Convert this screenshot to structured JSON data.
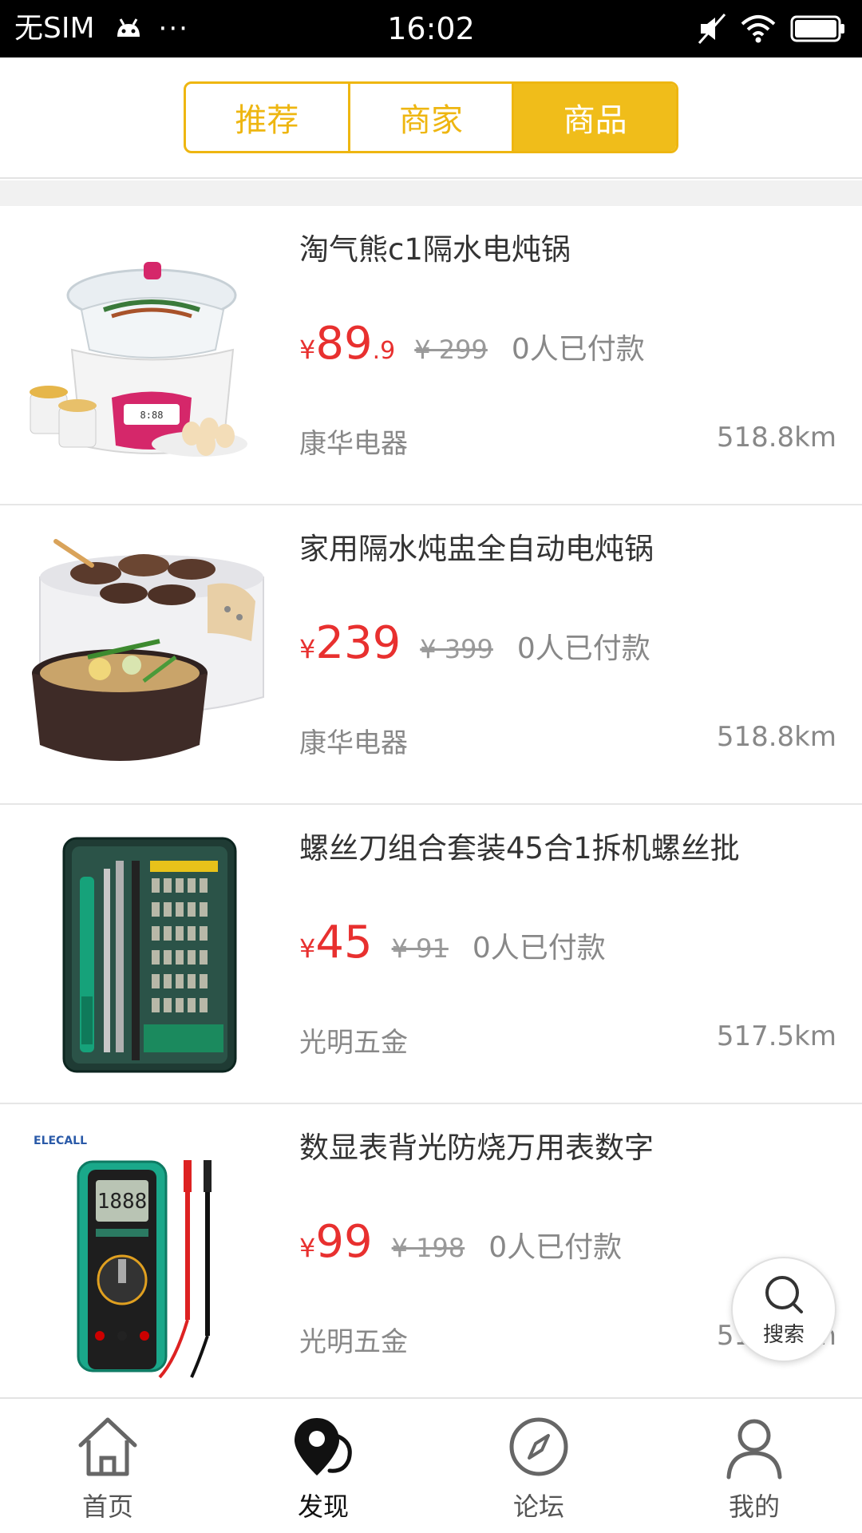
{
  "status_bar": {
    "carrier": "无SIM",
    "dots": "···",
    "time": "16:02"
  },
  "header": {
    "tabs": [
      {
        "label": "推荐",
        "active": false
      },
      {
        "label": "商家",
        "active": false
      },
      {
        "label": "商品",
        "active": true
      }
    ],
    "accent_color": "#f0bd1a"
  },
  "products": [
    {
      "title": "淘气熊c1隔水电炖锅",
      "yen": "¥",
      "price_int": "89",
      "price_dec": ".9",
      "original_price": "¥ 299",
      "paid": "0人已付款",
      "shop": "康华电器",
      "distance": "518.8km",
      "image": "electric-stew-pot-image"
    },
    {
      "title": "家用隔水炖盅全自动电炖锅",
      "yen": "¥",
      "price_int": "239",
      "price_dec": "",
      "original_price": "¥ 399",
      "paid": "0人已付款",
      "shop": "康华电器",
      "distance": "518.8km",
      "image": "stew-cooker-set-image"
    },
    {
      "title": "螺丝刀组合套装45合1拆机螺丝批",
      "yen": "¥",
      "price_int": "45",
      "price_dec": "",
      "original_price": "¥ 91",
      "paid": "0人已付款",
      "shop": "光明五金",
      "distance": "517.5km",
      "image": "screwdriver-set-image"
    },
    {
      "title": "数显表背光防烧万用表数字",
      "yen": "¥",
      "price_int": "99",
      "price_dec": "",
      "original_price": "¥ 198",
      "paid": "0人已付款",
      "shop": "光明五金",
      "distance": "517.5km",
      "image": "multimeter-image"
    }
  ],
  "price_color": "#e8302f",
  "multimeter_brand": "ELECALL",
  "multimeter_display": "1888",
  "fab": {
    "label": "搜索",
    "icon": "search-icon"
  },
  "tabbar": [
    {
      "label": "首页",
      "icon": "home-icon",
      "active": false
    },
    {
      "label": "发现",
      "icon": "location-pin-icon",
      "active": true
    },
    {
      "label": "论坛",
      "icon": "compass-icon",
      "active": false
    },
    {
      "label": "我的",
      "icon": "user-icon",
      "active": false
    }
  ]
}
